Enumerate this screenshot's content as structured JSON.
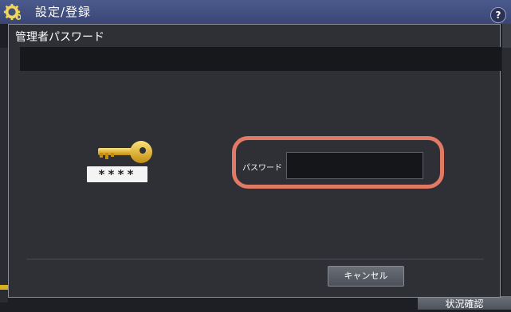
{
  "appbar": {
    "title": "設定/登録",
    "help_label": "?"
  },
  "dialog": {
    "title": "管理者パスワード",
    "message": "",
    "key_masked_text": "****",
    "password": {
      "label": "パスワード",
      "value": "",
      "placeholder": ""
    },
    "cancel_label": "キャンセル"
  },
  "status_button_label": "状況確認",
  "colors": {
    "appbar": "#3a4675",
    "dialog_bg": "#2e3036",
    "highlight": "#e07a64",
    "key": "#e2b21f"
  }
}
